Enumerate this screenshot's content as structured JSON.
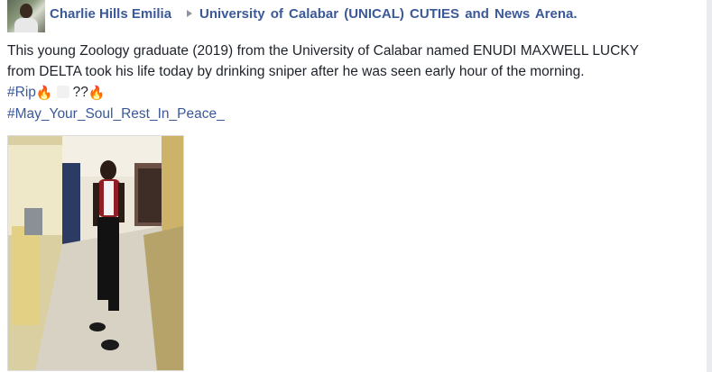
{
  "post": {
    "author": "Charlie Hills Emilia",
    "group": "University of Calabar (UNICAL) CUTIES and News Arena.",
    "text": "This young Zoology graduate (2019) from the University of Calabar named ENUDI MAXWELL LUCKY from DELTA took his life today by drinking sniper after he was seen early hour of the morning.",
    "hashtag_rip": "#Rip",
    "rip_suffix": "??",
    "hashtag_rest": "#May_Your_Soul_Rest_In_Peace_",
    "emoji_icon": "fire-emoji"
  },
  "colors": {
    "link": "#3b5998",
    "text": "#1d2129"
  }
}
